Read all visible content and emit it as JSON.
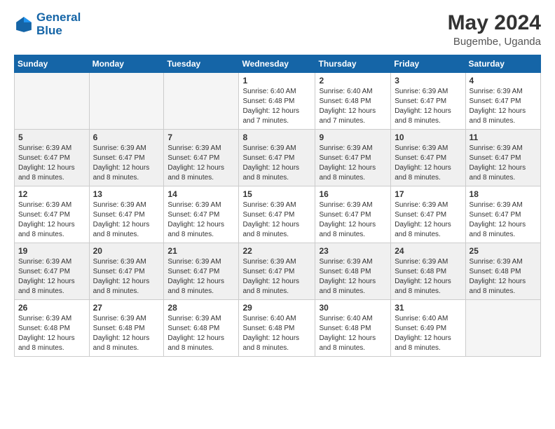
{
  "logo": {
    "line1": "General",
    "line2": "Blue"
  },
  "title": "May 2024",
  "location": "Bugembe, Uganda",
  "days_header": [
    "Sunday",
    "Monday",
    "Tuesday",
    "Wednesday",
    "Thursday",
    "Friday",
    "Saturday"
  ],
  "weeks": [
    [
      {
        "day": "",
        "text": ""
      },
      {
        "day": "",
        "text": ""
      },
      {
        "day": "",
        "text": ""
      },
      {
        "day": "1",
        "text": "Sunrise: 6:40 AM\nSunset: 6:48 PM\nDaylight: 12 hours\nand 7 minutes."
      },
      {
        "day": "2",
        "text": "Sunrise: 6:40 AM\nSunset: 6:48 PM\nDaylight: 12 hours\nand 7 minutes."
      },
      {
        "day": "3",
        "text": "Sunrise: 6:39 AM\nSunset: 6:47 PM\nDaylight: 12 hours\nand 8 minutes."
      },
      {
        "day": "4",
        "text": "Sunrise: 6:39 AM\nSunset: 6:47 PM\nDaylight: 12 hours\nand 8 minutes."
      }
    ],
    [
      {
        "day": "5",
        "text": "Sunrise: 6:39 AM\nSunset: 6:47 PM\nDaylight: 12 hours\nand 8 minutes."
      },
      {
        "day": "6",
        "text": "Sunrise: 6:39 AM\nSunset: 6:47 PM\nDaylight: 12 hours\nand 8 minutes."
      },
      {
        "day": "7",
        "text": "Sunrise: 6:39 AM\nSunset: 6:47 PM\nDaylight: 12 hours\nand 8 minutes."
      },
      {
        "day": "8",
        "text": "Sunrise: 6:39 AM\nSunset: 6:47 PM\nDaylight: 12 hours\nand 8 minutes."
      },
      {
        "day": "9",
        "text": "Sunrise: 6:39 AM\nSunset: 6:47 PM\nDaylight: 12 hours\nand 8 minutes."
      },
      {
        "day": "10",
        "text": "Sunrise: 6:39 AM\nSunset: 6:47 PM\nDaylight: 12 hours\nand 8 minutes."
      },
      {
        "day": "11",
        "text": "Sunrise: 6:39 AM\nSunset: 6:47 PM\nDaylight: 12 hours\nand 8 minutes."
      }
    ],
    [
      {
        "day": "12",
        "text": "Sunrise: 6:39 AM\nSunset: 6:47 PM\nDaylight: 12 hours\nand 8 minutes."
      },
      {
        "day": "13",
        "text": "Sunrise: 6:39 AM\nSunset: 6:47 PM\nDaylight: 12 hours\nand 8 minutes."
      },
      {
        "day": "14",
        "text": "Sunrise: 6:39 AM\nSunset: 6:47 PM\nDaylight: 12 hours\nand 8 minutes."
      },
      {
        "day": "15",
        "text": "Sunrise: 6:39 AM\nSunset: 6:47 PM\nDaylight: 12 hours\nand 8 minutes."
      },
      {
        "day": "16",
        "text": "Sunrise: 6:39 AM\nSunset: 6:47 PM\nDaylight: 12 hours\nand 8 minutes."
      },
      {
        "day": "17",
        "text": "Sunrise: 6:39 AM\nSunset: 6:47 PM\nDaylight: 12 hours\nand 8 minutes."
      },
      {
        "day": "18",
        "text": "Sunrise: 6:39 AM\nSunset: 6:47 PM\nDaylight: 12 hours\nand 8 minutes."
      }
    ],
    [
      {
        "day": "19",
        "text": "Sunrise: 6:39 AM\nSunset: 6:47 PM\nDaylight: 12 hours\nand 8 minutes."
      },
      {
        "day": "20",
        "text": "Sunrise: 6:39 AM\nSunset: 6:47 PM\nDaylight: 12 hours\nand 8 minutes."
      },
      {
        "day": "21",
        "text": "Sunrise: 6:39 AM\nSunset: 6:47 PM\nDaylight: 12 hours\nand 8 minutes."
      },
      {
        "day": "22",
        "text": "Sunrise: 6:39 AM\nSunset: 6:47 PM\nDaylight: 12 hours\nand 8 minutes."
      },
      {
        "day": "23",
        "text": "Sunrise: 6:39 AM\nSunset: 6:48 PM\nDaylight: 12 hours\nand 8 minutes."
      },
      {
        "day": "24",
        "text": "Sunrise: 6:39 AM\nSunset: 6:48 PM\nDaylight: 12 hours\nand 8 minutes."
      },
      {
        "day": "25",
        "text": "Sunrise: 6:39 AM\nSunset: 6:48 PM\nDaylight: 12 hours\nand 8 minutes."
      }
    ],
    [
      {
        "day": "26",
        "text": "Sunrise: 6:39 AM\nSunset: 6:48 PM\nDaylight: 12 hours\nand 8 minutes."
      },
      {
        "day": "27",
        "text": "Sunrise: 6:39 AM\nSunset: 6:48 PM\nDaylight: 12 hours\nand 8 minutes."
      },
      {
        "day": "28",
        "text": "Sunrise: 6:39 AM\nSunset: 6:48 PM\nDaylight: 12 hours\nand 8 minutes."
      },
      {
        "day": "29",
        "text": "Sunrise: 6:40 AM\nSunset: 6:48 PM\nDaylight: 12 hours\nand 8 minutes."
      },
      {
        "day": "30",
        "text": "Sunrise: 6:40 AM\nSunset: 6:48 PM\nDaylight: 12 hours\nand 8 minutes."
      },
      {
        "day": "31",
        "text": "Sunrise: 6:40 AM\nSunset: 6:49 PM\nDaylight: 12 hours\nand 8 minutes."
      },
      {
        "day": "",
        "text": ""
      }
    ]
  ]
}
